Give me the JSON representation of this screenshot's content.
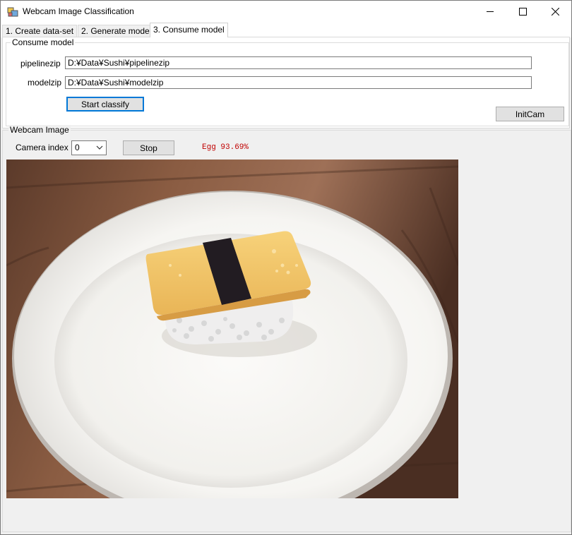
{
  "window": {
    "title": "Webcam Image Classification",
    "icon": "app-icon",
    "controls": [
      "minimize-icon",
      "maximize-icon",
      "close-icon"
    ]
  },
  "tabs": [
    {
      "label": "1. Create data-set",
      "active": false
    },
    {
      "label": "2. Generate model",
      "active": false
    },
    {
      "label": "3. Consume model",
      "active": true
    }
  ],
  "consume": {
    "group_label": "Consume model",
    "pipeline_label": "pipelinezip",
    "pipeline_value": "D:¥Data¥Sushi¥pipelinezip",
    "model_label": "modelzip",
    "model_value": "D:¥Data¥Sushi¥modelzip",
    "start_label": "Start classify",
    "initcam_label": "InitCam"
  },
  "webcam": {
    "group_label": "Webcam Image",
    "camera_index_label": "Camera index",
    "camera_index_value": "0",
    "stop_label": "Stop",
    "result_text": "Egg 93.69%",
    "result_color": "#c00000"
  }
}
